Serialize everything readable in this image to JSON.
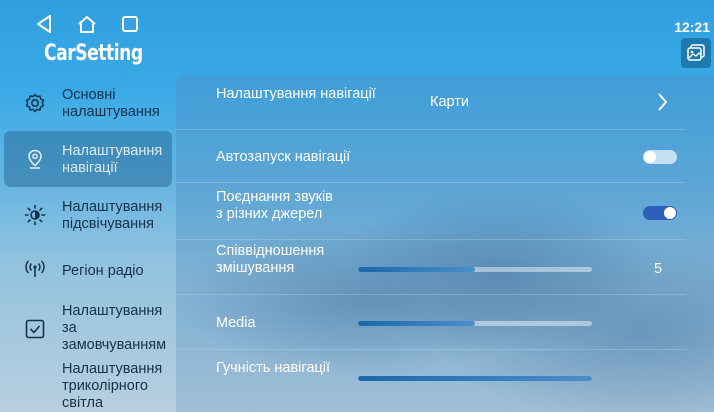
{
  "status": {
    "time": "12:21"
  },
  "app": {
    "title": "CarSetting"
  },
  "sidebar": {
    "items": [
      {
        "label": "Основні налаштування",
        "icon": "gear-icon",
        "active": false
      },
      {
        "label": "Налаштування навігації",
        "icon": "location-pin-icon",
        "active": true
      },
      {
        "label": "Налаштування підсвічування",
        "icon": "brightness-icon",
        "active": false
      },
      {
        "label": "Регіон радіо",
        "icon": "radio-antenna-icon",
        "active": false
      },
      {
        "label": "Налаштування за замовчуванням",
        "icon": "checkbox-icon",
        "active": false
      },
      {
        "label": "Налаштування триколірного світла",
        "icon": "",
        "active": false
      }
    ]
  },
  "settings": {
    "nav_app": {
      "label": "Налаштування навігації",
      "value": "Карти"
    },
    "autostart": {
      "label": "Автозапуск навігації",
      "enabled": false
    },
    "sound_mix": {
      "label": "Поєднання звуків з різних джерел",
      "enabled": true
    },
    "mix_ratio": {
      "label": "Співвідношення змішування",
      "value": "5",
      "level": 0.5
    },
    "media": {
      "label": "Media",
      "level": 0.5
    },
    "nav_volume": {
      "label": "Гучність навігації",
      "level": 1.0
    }
  },
  "colors": {
    "accent": "#2e5fb8",
    "panel": "#4b96cd",
    "active_item": "#1e5f8c"
  }
}
